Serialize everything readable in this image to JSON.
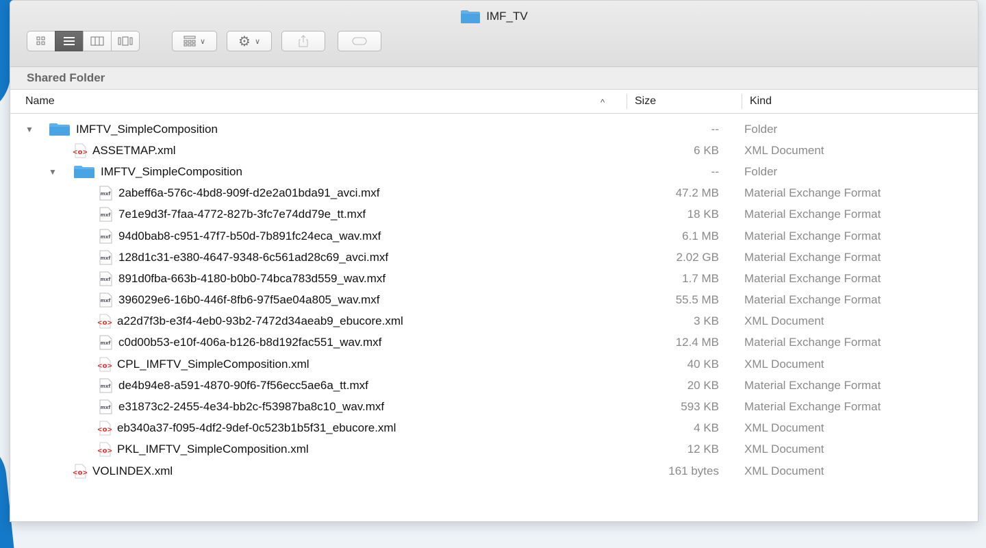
{
  "window": {
    "title": "IMF_TV"
  },
  "pathbar": {
    "label": "Shared Folder"
  },
  "columns": {
    "name": "Name",
    "size": "Size",
    "kind": "Kind",
    "sort_indicator": "^"
  },
  "rows": [
    {
      "name": "IMFTV_SimpleComposition",
      "size": "--",
      "kind": "Folder",
      "icon": "folder-icon",
      "level": 0,
      "expanded": true
    },
    {
      "name": "ASSETMAP.xml",
      "size": "6 KB",
      "kind": "XML Document",
      "icon": "xml-icon",
      "level": 1
    },
    {
      "name": "IMFTV_SimpleComposition",
      "size": "--",
      "kind": "Folder",
      "icon": "folder-icon",
      "level": 1,
      "expanded": true
    },
    {
      "name": "2abeff6a-576c-4bd8-909f-d2e2a01bda91_avci.mxf",
      "size": "47.2 MB",
      "kind": "Material Exchange Format",
      "icon": "mxf-icon",
      "level": 2
    },
    {
      "name": "7e1e9d3f-7faa-4772-827b-3fc7e74dd79e_tt.mxf",
      "size": "18 KB",
      "kind": "Material Exchange Format",
      "icon": "mxf-icon",
      "level": 2
    },
    {
      "name": "94d0bab8-c951-47f7-b50d-7b891fc24eca_wav.mxf",
      "size": "6.1 MB",
      "kind": "Material Exchange Format",
      "icon": "mxf-icon",
      "level": 2
    },
    {
      "name": "128d1c31-e380-4647-9348-6c561ad28c69_avci.mxf",
      "size": "2.02 GB",
      "kind": "Material Exchange Format",
      "icon": "mxf-icon",
      "level": 2
    },
    {
      "name": "891d0fba-663b-4180-b0b0-74bca783d559_wav.mxf",
      "size": "1.7 MB",
      "kind": "Material Exchange Format",
      "icon": "mxf-icon",
      "level": 2
    },
    {
      "name": "396029e6-16b0-446f-8fb6-97f5ae04a805_wav.mxf",
      "size": "55.5 MB",
      "kind": "Material Exchange Format",
      "icon": "mxf-icon",
      "level": 2
    },
    {
      "name": "a22d7f3b-e3f4-4eb0-93b2-7472d34aeab9_ebucore.xml",
      "size": "3 KB",
      "kind": "XML Document",
      "icon": "xml-icon",
      "level": 2
    },
    {
      "name": "c0d00b53-e10f-406a-b126-b8d192fac551_wav.mxf",
      "size": "12.4 MB",
      "kind": "Material Exchange Format",
      "icon": "mxf-icon",
      "level": 2
    },
    {
      "name": "CPL_IMFTV_SimpleComposition.xml",
      "size": "40 KB",
      "kind": "XML Document",
      "icon": "xml-icon",
      "level": 2
    },
    {
      "name": "de4b94e8-a591-4870-90f6-7f56ecc5ae6a_tt.mxf",
      "size": "20 KB",
      "kind": "Material Exchange Format",
      "icon": "mxf-icon",
      "level": 2
    },
    {
      "name": "e31873c2-2455-4e34-bb2c-f53987ba8c10_wav.mxf",
      "size": "593 KB",
      "kind": "Material Exchange Format",
      "icon": "mxf-icon",
      "level": 2
    },
    {
      "name": "eb340a37-f095-4df2-9def-0c523b1b5f31_ebucore.xml",
      "size": "4 KB",
      "kind": "XML Document",
      "icon": "xml-icon",
      "level": 2
    },
    {
      "name": "PKL_IMFTV_SimpleComposition.xml",
      "size": "12 KB",
      "kind": "XML Document",
      "icon": "xml-icon",
      "level": 2
    },
    {
      "name": "VOLINDEX.xml",
      "size": "161 bytes",
      "kind": "XML Document",
      "icon": "xml-icon",
      "level": 1
    }
  ],
  "colors": {
    "folder": "#52a9e8",
    "xml_red": "#e0302c",
    "kind_gray": "#8a8a8a",
    "accent_blue": "#1479c8"
  }
}
